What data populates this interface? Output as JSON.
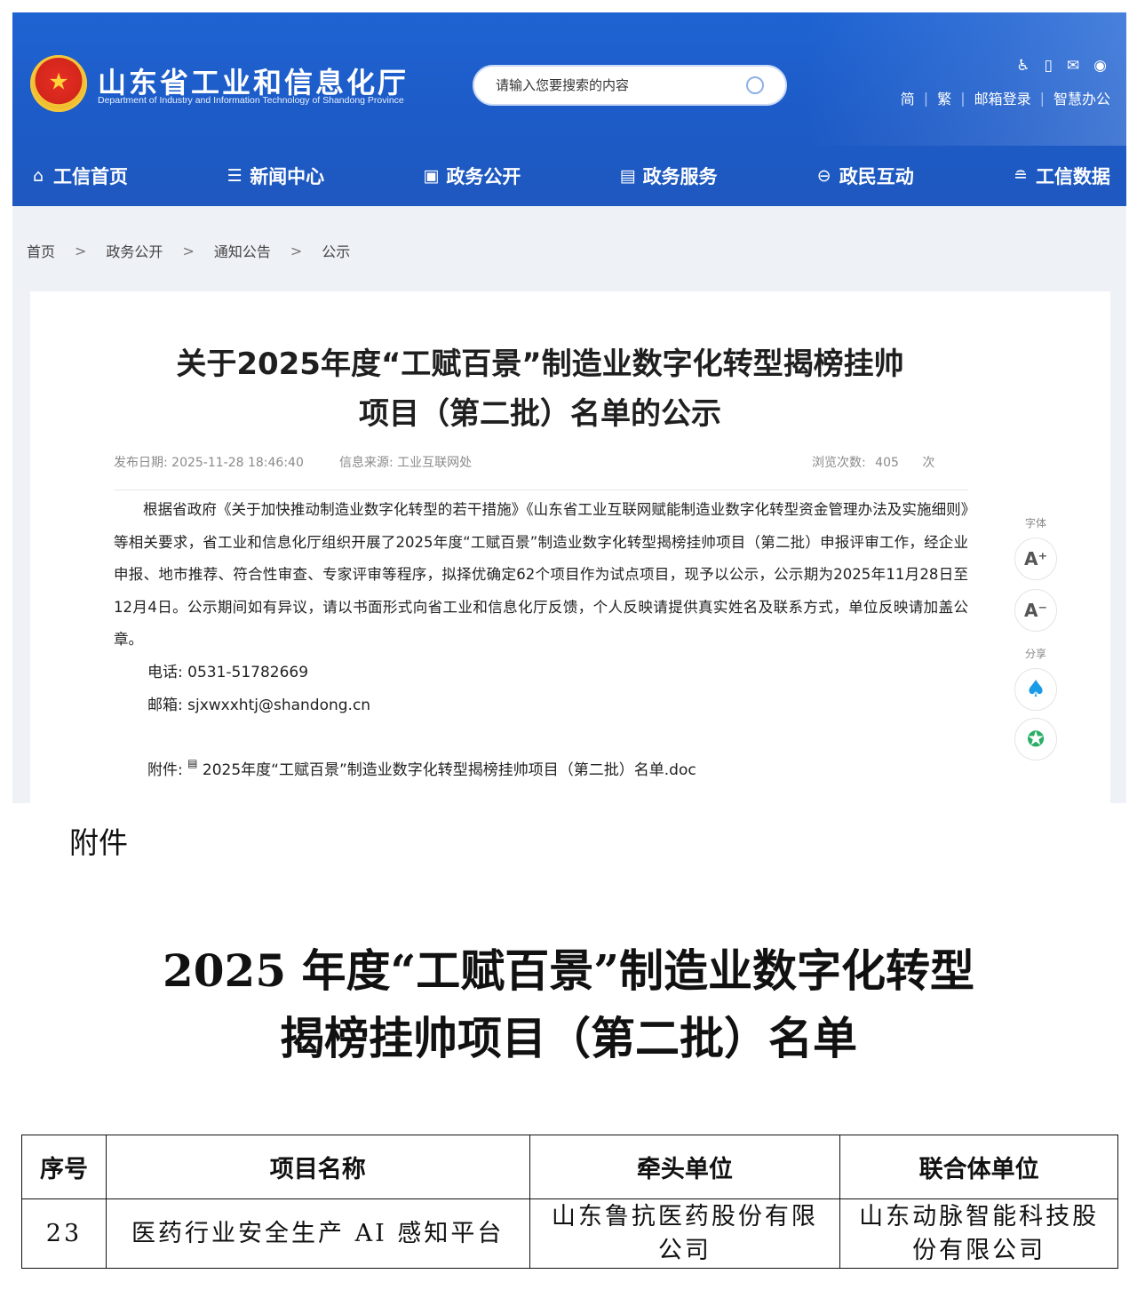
{
  "header": {
    "site_title": "山东省工业和信息化厅",
    "site_subtitle": "Department of Industry and Information Technology of Shandong Province",
    "search_placeholder": "请输入您要搜索的内容",
    "lang_simplified": "简",
    "lang_traditional": "繁",
    "mail_login": "邮箱登录",
    "smart_office": "智慧办公"
  },
  "nav": [
    {
      "label": "工信首页",
      "icon": "home-icon"
    },
    {
      "label": "新闻中心",
      "icon": "news-icon"
    },
    {
      "label": "政务公开",
      "icon": "monitor-icon"
    },
    {
      "label": "政务服务",
      "icon": "service-icon"
    },
    {
      "label": "政民互动",
      "icon": "chat-icon"
    },
    {
      "label": "工信数据",
      "icon": "database-icon"
    }
  ],
  "breadcrumb": [
    "首页",
    "政务公开",
    "通知公告",
    "公示"
  ],
  "article": {
    "title_line1": "关于2025年度“工赋百景”制造业数字化转型揭榜挂帅",
    "title_line2": "项目（第二批）名单的公示",
    "publish_label": "发布日期:",
    "publish_date": "2025-11-28 18:46:40",
    "source_label": "信息来源:",
    "source": "工业互联网处",
    "views_label": "浏览次数:",
    "views": "405",
    "views_unit": "次",
    "body": "根据省政府《关于加快推动制造业数字化转型的若干措施》《山东省工业互联网赋能制造业数字化转型资金管理办法及实施细则》等相关要求，省工业和信息化厅组织开展了2025年度“工赋百景”制造业数字化转型揭榜挂帅项目（第二批）申报评审工作，经企业申报、地市推荐、符合性审查、专家评审等程序，拟择优确定62个项目作为试点项目，现予以公示，公示期为2025年11月28日至12月4日。公示期间如有异议，请以书面形式向省工业和信息化厅反馈，个人反映请提供真实姓名及联系方式，单位反映请加盖公章。",
    "phone_label": "电话:",
    "phone": "0531-51782669",
    "email_label": "邮箱:",
    "email": "sjxwxxhtj@shandong.cn",
    "attachment_label": "附件:",
    "attachment_file": "2025年度“工赋百景”制造业数字化转型揭榜挂帅项目（第二批）名单.doc"
  },
  "side_tools": {
    "font_label": "字体",
    "font_increase": "A⁺",
    "font_decrease": "A⁻",
    "share_label": "分享"
  },
  "document": {
    "label": "附件",
    "title_line1": "2025 年度“工赋百景”制造业数字化转型",
    "title_line2": "揭榜挂帅项目（第二批）名单",
    "columns": [
      "序号",
      "项目名称",
      "牵头单位",
      "联合体单位"
    ],
    "rows": [
      [
        "23",
        "医药行业安全生产 AI 感知平台",
        "山东鲁抗医药股份有限公司",
        "山东动脉智能科技股份有限公司"
      ]
    ]
  }
}
